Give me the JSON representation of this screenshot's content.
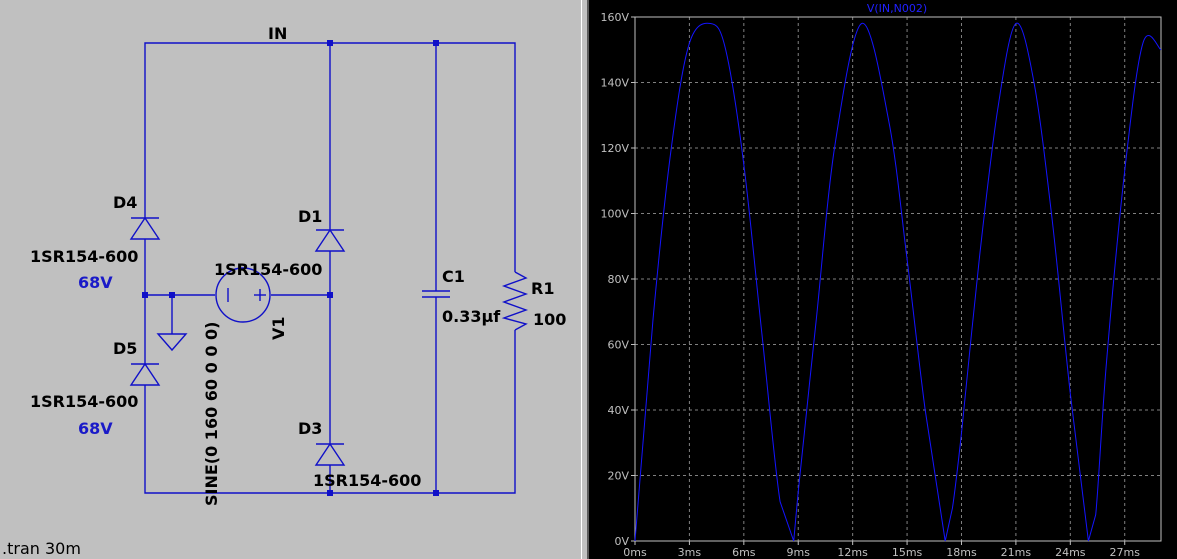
{
  "schematic": {
    "net_label_in": "IN",
    "directive": ".tran 30m",
    "components": {
      "d1": {
        "ref": "D1",
        "model": "1SR154-600"
      },
      "d3": {
        "ref": "D3",
        "model": "1SR154-600"
      },
      "d4": {
        "ref": "D4",
        "model": "1SR154-600",
        "voltage": "68V"
      },
      "d5": {
        "ref": "D5",
        "model": "1SR154-600",
        "voltage": "68V"
      },
      "v1": {
        "ref": "V1",
        "value": "SINE(0 160 60 0 0 0)"
      },
      "c1": {
        "ref": "C1",
        "value": "0.33µf"
      },
      "r1": {
        "ref": "R1",
        "value": "100"
      }
    },
    "wire_color": "#1010c8",
    "background": "#c0c0c0"
  },
  "plot": {
    "trace_color": "#1414ff",
    "background": "#000000",
    "chart_data": {
      "type": "line",
      "title": "V(IN,N002)",
      "ylim": [
        0,
        160
      ],
      "xlim": [
        0,
        29
      ],
      "y_ticks": [
        "0V",
        "20V",
        "40V",
        "60V",
        "80V",
        "100V",
        "120V",
        "140V",
        "160V"
      ],
      "y_tick_values": [
        0,
        20,
        40,
        60,
        80,
        100,
        120,
        140,
        160
      ],
      "x_ticks": [
        "0ms",
        "3ms",
        "6ms",
        "9ms",
        "12ms",
        "15ms",
        "18ms",
        "21ms",
        "24ms",
        "27ms"
      ],
      "x_tick_values": [
        0,
        3,
        6,
        9,
        12,
        15,
        18,
        21,
        24,
        27
      ],
      "grid": true,
      "series": [
        {
          "name": "V(IN,N002)",
          "x": [
            0,
            1.0,
            2.0,
            3.0,
            4.17,
            5.0,
            6.0,
            7.0,
            8.0,
            8.75,
            9.0,
            10.0,
            11.0,
            12.5,
            14.0,
            15.0,
            16.0,
            17.1,
            17.5,
            18.0,
            19.0,
            20.0,
            21.0,
            22.0,
            23.0,
            24.0,
            25.0,
            25.4,
            26.0,
            27.0,
            28.0,
            29.0
          ],
          "y": [
            0,
            68,
            120,
            152,
            158,
            150,
            115,
            63,
            12,
            0,
            15,
            68,
            120,
            158,
            128,
            86,
            40,
            0,
            10,
            33,
            87,
            132,
            158,
            140,
            98,
            45,
            0,
            8,
            55,
            113,
            152,
            150
          ]
        }
      ]
    }
  }
}
